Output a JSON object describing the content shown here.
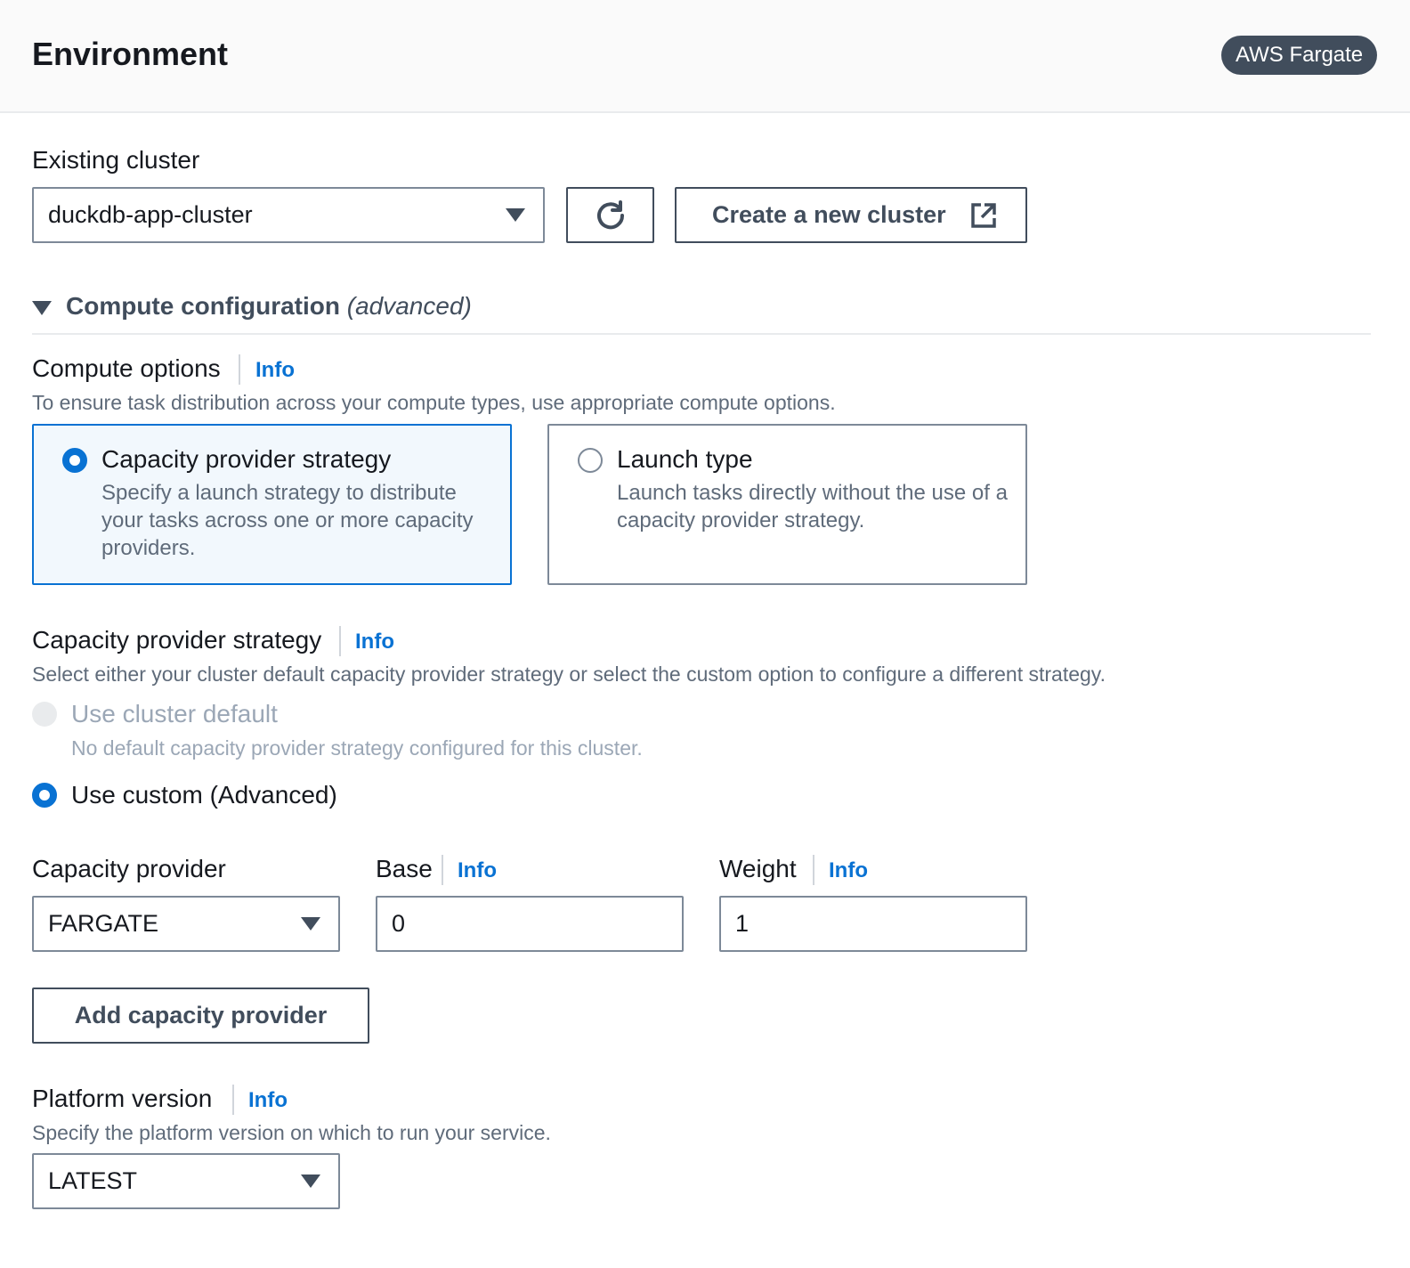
{
  "header": {
    "title": "Environment",
    "badge": "AWS Fargate"
  },
  "existing_cluster": {
    "label": "Existing cluster",
    "selected": "duckdb-app-cluster",
    "refresh_icon": "refresh-icon",
    "create_button": "Create a new cluster",
    "create_icon": "external-link-icon"
  },
  "compute_config": {
    "title": "Compute configuration",
    "title_suffix": "(advanced)"
  },
  "compute_options": {
    "label": "Compute options",
    "info": "Info",
    "description": "To ensure task distribution across your compute types, use appropriate compute options.",
    "tiles": [
      {
        "title": "Capacity provider strategy",
        "description": "Specify a launch strategy to distribute your tasks across one or more capacity providers.",
        "selected": true
      },
      {
        "title": "Launch type",
        "description": "Launch tasks directly without the use of a capacity provider strategy.",
        "selected": false
      }
    ]
  },
  "capacity_strategy": {
    "label": "Capacity provider strategy",
    "info": "Info",
    "description": "Select either your cluster default capacity provider strategy or select the custom option to configure a different strategy.",
    "default_option": {
      "label": "Use cluster default",
      "description": "No default capacity provider strategy configured for this cluster.",
      "disabled": true
    },
    "custom_option": {
      "label": "Use custom (Advanced)",
      "selected": true
    }
  },
  "provider_row": {
    "provider_label": "Capacity provider",
    "provider_value": "FARGATE",
    "base_label": "Base",
    "base_info": "Info",
    "base_value": "0",
    "weight_label": "Weight",
    "weight_info": "Info",
    "weight_value": "1"
  },
  "add_button": "Add capacity provider",
  "platform_version": {
    "label": "Platform version",
    "info": "Info",
    "description": "Specify the platform version on which to run your service.",
    "value": "LATEST"
  },
  "colors": {
    "accent": "#0972d3",
    "badge_bg": "#414d5c",
    "text": "#16191f",
    "muted": "#5f6b7a"
  }
}
